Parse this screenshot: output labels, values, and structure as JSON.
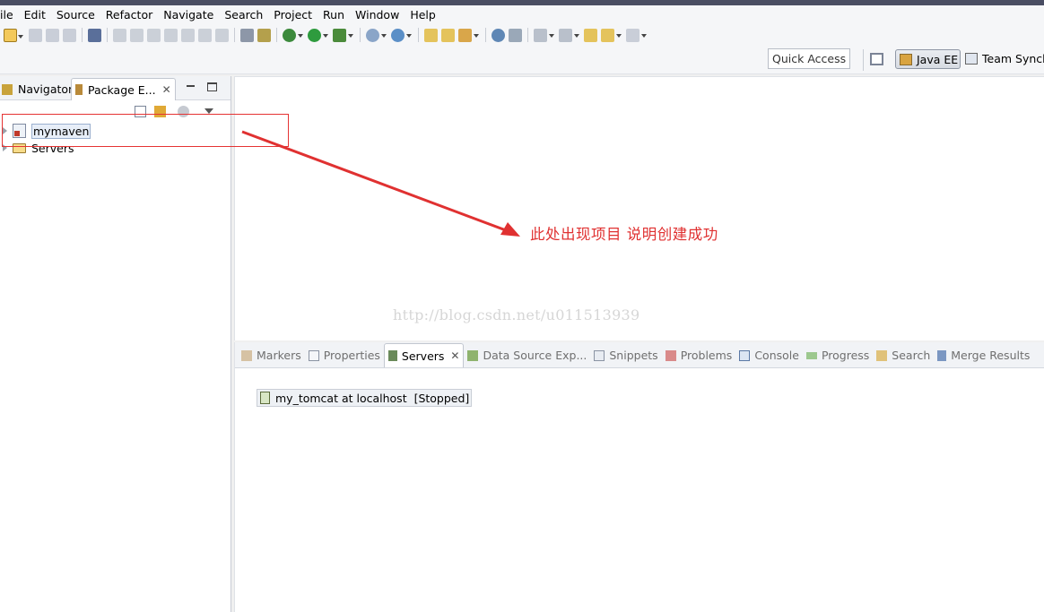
{
  "menubar": {
    "items": [
      "ile",
      "Edit",
      "Source",
      "Refactor",
      "Navigate",
      "Search",
      "Project",
      "Run",
      "Window",
      "Help"
    ]
  },
  "toolbar": {
    "icons": [
      "new-icon",
      "save-icon",
      "save-all-icon",
      "print-icon",
      "skip-breakpoints-icon",
      "resume-icon",
      "suspend-icon",
      "terminate-icon",
      "disconnect-icon",
      "step-into-icon",
      "step-over-icon",
      "step-return-icon",
      "drop-to-frame-icon",
      "use-step-filters-icon",
      "debug-icon",
      "run-icon",
      "run-external-tools-icon",
      "new-server-icon",
      "new-java-class-icon",
      "open-type-icon",
      "open-task-icon",
      "search-icon",
      "web-browser-icon",
      "next-annotation-icon",
      "previous-annotation-icon",
      "last-edit-location-icon",
      "back-icon",
      "forward-icon"
    ]
  },
  "perspective": {
    "quick_access_placeholder": "Quick Access",
    "java_ee_label": "Java EE",
    "team_sync_label": "Team Synch"
  },
  "left_view": {
    "tabs": [
      {
        "label": "Navigator"
      },
      {
        "label": "Package E..."
      }
    ],
    "tree": [
      {
        "label": "mymaven",
        "type": "maven-project"
      },
      {
        "label": "Servers",
        "type": "folder"
      }
    ]
  },
  "editor": {
    "annotation": "此处出现项目  说明创建成功",
    "watermark": "http://blog.csdn.net/u011513939",
    "annotation_color": "#e03131"
  },
  "bottom_view": {
    "tabs": [
      {
        "label": "Markers",
        "active": false
      },
      {
        "label": "Properties",
        "active": false
      },
      {
        "label": "Servers",
        "active": true
      },
      {
        "label": "Data Source Exp...",
        "active": false
      },
      {
        "label": "Snippets",
        "active": false
      },
      {
        "label": "Problems",
        "active": false
      },
      {
        "label": "Console",
        "active": false
      },
      {
        "label": "Progress",
        "active": false
      },
      {
        "label": "Search",
        "active": false
      },
      {
        "label": "Merge Results",
        "active": false
      }
    ],
    "server": {
      "name": "my_tomcat at localhost",
      "status": "[Stopped]"
    }
  }
}
